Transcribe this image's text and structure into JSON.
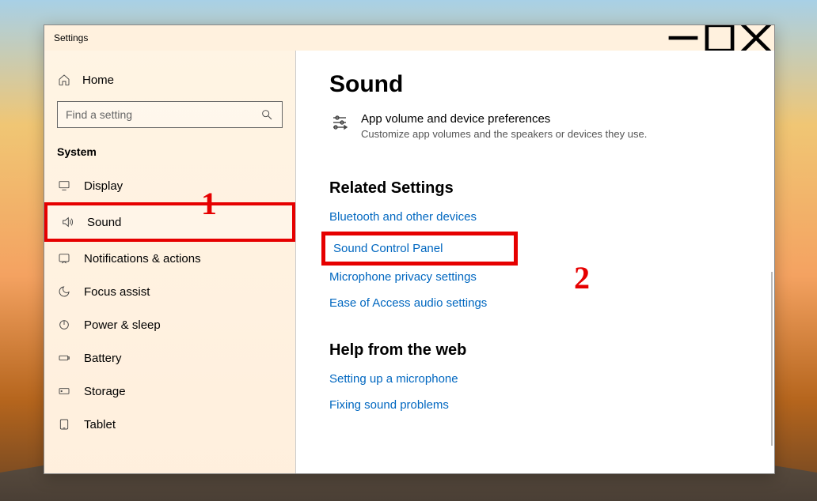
{
  "window": {
    "title": "Settings"
  },
  "sidebar": {
    "home": "Home",
    "search_placeholder": "Find a setting",
    "category": "System",
    "items": [
      {
        "label": "Display",
        "icon": "display"
      },
      {
        "label": "Sound",
        "icon": "sound",
        "selected": true
      },
      {
        "label": "Notifications & actions",
        "icon": "notifications"
      },
      {
        "label": "Focus assist",
        "icon": "focus"
      },
      {
        "label": "Power & sleep",
        "icon": "power"
      },
      {
        "label": "Battery",
        "icon": "battery"
      },
      {
        "label": "Storage",
        "icon": "storage"
      },
      {
        "label": "Tablet",
        "icon": "tablet"
      }
    ]
  },
  "content": {
    "title": "Sound",
    "pref": {
      "title": "App volume and device preferences",
      "desc": "Customize app volumes and the speakers or devices they use."
    },
    "related": {
      "heading": "Related Settings",
      "links": [
        "Bluetooth and other devices",
        "Sound Control Panel",
        "Microphone privacy settings",
        "Ease of Access audio settings"
      ],
      "highlight_index": 1
    },
    "help": {
      "heading": "Help from the web",
      "links": [
        "Setting up a microphone",
        "Fixing sound problems"
      ]
    }
  },
  "annotations": {
    "a1": "1",
    "a2": "2"
  }
}
